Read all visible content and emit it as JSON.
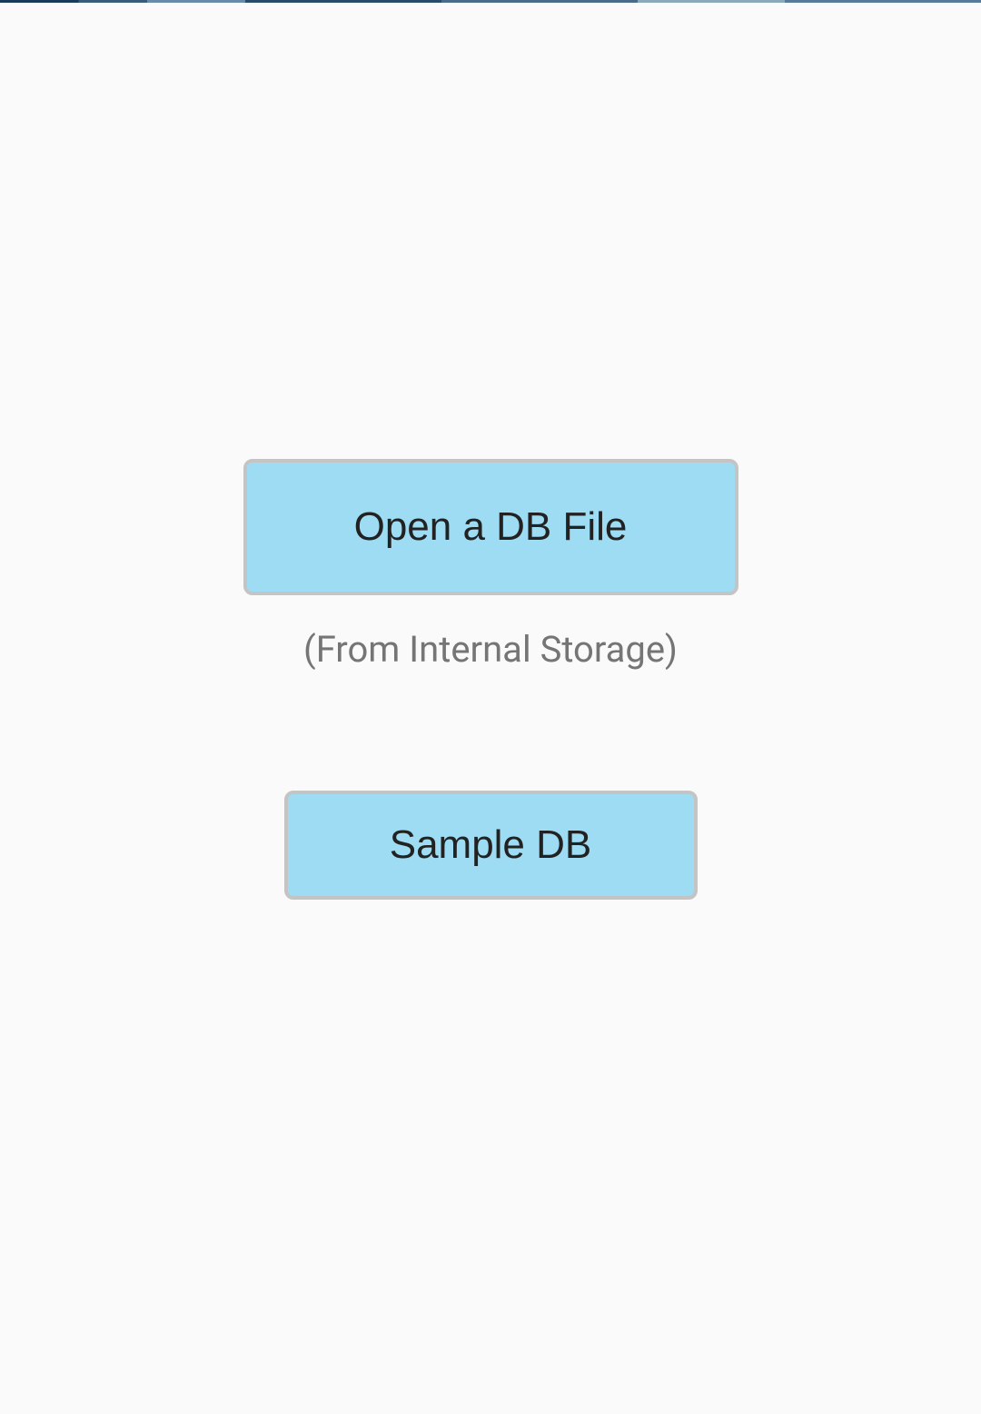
{
  "buttons": {
    "open_db_label": "Open a DB File",
    "sample_db_label": "Sample DB"
  },
  "subtitle_text": "(From Internal Storage)"
}
